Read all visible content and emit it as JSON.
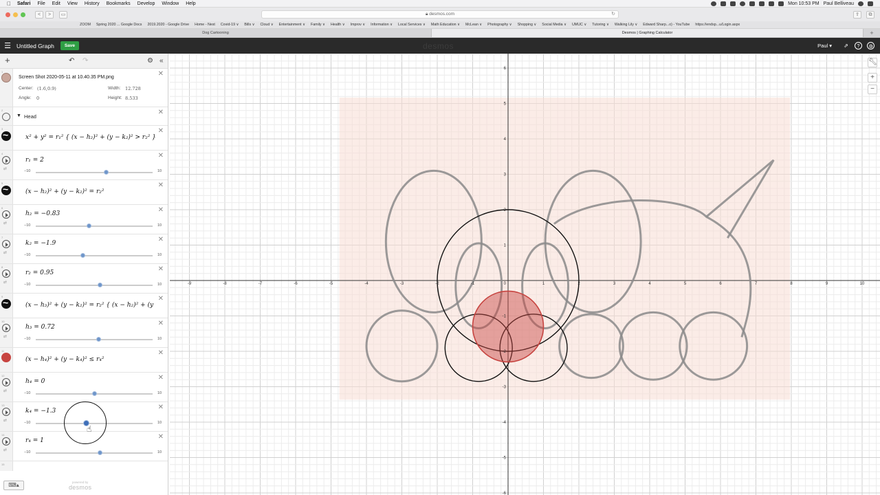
{
  "menubar": {
    "apple": "",
    "app": "Safari",
    "items": [
      "File",
      "Edit",
      "View",
      "History",
      "Bookmarks",
      "Develop",
      "Window",
      "Help"
    ],
    "clock": "Mon 10:53 PM",
    "user": "Paul Belliveau"
  },
  "safari": {
    "url": "desmos.com",
    "favorites": [
      "ZOOM",
      "Spring 2020 ... Google Docs",
      "2019.2020 - Google Drive",
      "Home - Nest",
      "Covid-19 ∨",
      "Bills ∨",
      "Cloud ∨",
      "Entertainment ∨",
      "Family ∨",
      "Health ∨",
      "Improv ∨",
      "Information ∨",
      "Local Services ∨",
      "Math Education ∨",
      "McLean ∨",
      "Photography ∨",
      "Shopping ∨",
      "Social Media ∨",
      "UMUC ∨",
      "Tutoring ∨",
      "Walking Lily ∨",
      "Edward Sharp...o) - YouTube",
      "https://endsp...u/Login.aspx"
    ],
    "tabs": [
      {
        "label": "Dog Cartooning",
        "active": false
      },
      {
        "label": "Desmos | Graphing Calculator",
        "active": true
      }
    ]
  },
  "desmos": {
    "graph_title": "Untitled Graph",
    "save_label": "Save",
    "logo": "desmos",
    "user": "Paul ▾",
    "powered_by": "powered by",
    "brand": "desmos"
  },
  "expressions": {
    "image": {
      "title": "Screen Shot 2020-05-11 at 10.40.35 PM.png",
      "center_label": "Center:",
      "center_value": "(1.6,0.9)",
      "width_label": "Width:",
      "width_value": "12.728",
      "angle_label": "Angle:",
      "angle_value": "0",
      "height_label": "Height:",
      "height_value": "8.533"
    },
    "folder_title": "Head",
    "e3": "x² + y² = r₁² { (x − h₂)² + (y − k₂)² > r₂² } {",
    "r1": "r₁ = 2",
    "e5": "(x − h₂)² + (y − k₂)² = r₂²",
    "h2": "h₂ = −0.83",
    "k2": "k₂ = −1.9",
    "r2": "r₂ = 0.95",
    "e9": "(x − h₃)² + (y − k₂)² = r₂² { (x − h₂)² + (y",
    "h3": "h₃ = 0.72",
    "e11": "(x − h₄)² + (y − k₄)² ≤ r₄²",
    "h4": "h₄ = 0",
    "k4": "k₄ = −1.3",
    "r4": "r₄ = 1",
    "slider_min": "−10",
    "slider_max": "10"
  },
  "sliders": {
    "r1": 2,
    "h2": -0.83,
    "k2": -1.9,
    "r2": 0.95,
    "h3": 0.72,
    "h4": 0,
    "k4": -1.3,
    "r4": 1,
    "min": -10,
    "max": 10
  },
  "graph": {
    "x_range": [
      -9,
      10
    ],
    "y_range": [
      -6,
      6
    ],
    "x_ticks": [
      "-9",
      "-8",
      "-7",
      "-6",
      "-5",
      "-4",
      "-3",
      "-2",
      "-1",
      "0",
      "1",
      "2",
      "3",
      "4",
      "5",
      "6",
      "7",
      "8",
      "9",
      "10"
    ],
    "y_ticks": [
      "6",
      "5",
      "4",
      "3",
      "2",
      "1",
      "-1",
      "-2",
      "-3",
      "-4",
      "-5",
      "-6"
    ],
    "grid": true,
    "image_center": [
      1.6,
      0.9
    ],
    "image_width": 12.728,
    "image_height": 8.533,
    "curve_color": "#111111",
    "fill_color": "#c74440",
    "image_tint": "#f7dcd4"
  }
}
